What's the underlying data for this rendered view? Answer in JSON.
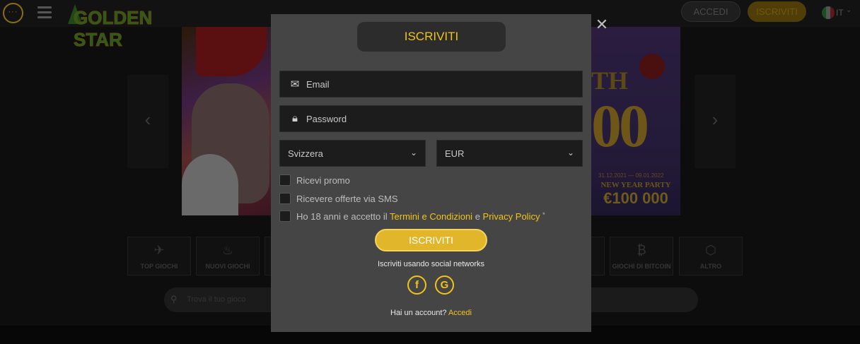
{
  "header": {
    "chat_glyph": "···",
    "logo_text": "GOLDEN STAR",
    "login_label": "ACCEDI",
    "register_label": "ISCRIVITI",
    "language": "IT"
  },
  "banner": {
    "right_top_text": "TH",
    "right_big_text": "00",
    "right_dates": "31.12.2021 — 09.01.2022",
    "right_party": "NEW YEAR PARTY",
    "right_prize": "€100 000",
    "prev_glyph": "‹",
    "next_glyph": "›"
  },
  "categories": [
    {
      "label": "TOP GIOCHI",
      "icon": "rocket-icon",
      "glyph": "✈"
    },
    {
      "label": "NUOVI GIOCHI",
      "icon": "flame-icon",
      "glyph": "♨"
    },
    {
      "label": "",
      "icon": "category-icon",
      "glyph": ""
    },
    {
      "label": "",
      "icon": "category-icon",
      "glyph": ""
    },
    {
      "label": "",
      "icon": "category-icon",
      "glyph": ""
    },
    {
      "label": "",
      "icon": "category-icon",
      "glyph": ""
    },
    {
      "label": "",
      "icon": "category-icon",
      "glyph": ""
    },
    {
      "label": "GIOCHI DI BITCOIN",
      "icon": "bitcoin-icon",
      "glyph": "₿"
    },
    {
      "label": "ALTRO",
      "icon": "cube-icon",
      "glyph": "⬡"
    }
  ],
  "search": {
    "placeholder": "Trova il tuo gioco"
  },
  "modal": {
    "title": "ISCRIVITI",
    "close_glyph": "✕",
    "email_placeholder": "Email",
    "password_placeholder": "Password",
    "country_value": "Svizzera",
    "currency_value": "EUR",
    "checkbox_promo": "Ricevi promo",
    "checkbox_sms": "Ricevere offerte via SMS",
    "terms_prefix": "Ho 18 anni e accetto il ",
    "terms_link": "Termini e Condizioni",
    "terms_middle": " e ",
    "privacy_link": "Privacy Policy",
    "terms_asterisk": "*",
    "submit_label": "ISCRIVITI",
    "social_title": "Iscriviti usando social networks",
    "facebook_glyph": "f",
    "google_glyph": "G",
    "have_account_text": "Hai un account?",
    "login_link": "Accedi"
  },
  "colors": {
    "accent": "#f0c419",
    "modal_bg": "#454545",
    "field_bg": "#1c1c1c"
  }
}
